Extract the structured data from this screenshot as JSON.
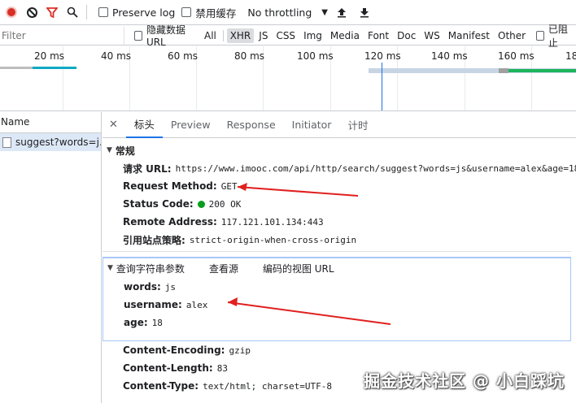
{
  "toolbar": {
    "preserve_log": "Preserve log",
    "disable_cache": "禁用缓存",
    "throttling": "No throttling"
  },
  "filter": {
    "placeholder": "Filter",
    "hide_data_url": "隐藏数据 URL",
    "types": [
      "All",
      "XHR",
      "JS",
      "CSS",
      "Img",
      "Media",
      "Font",
      "Doc",
      "WS",
      "Manifest",
      "Other"
    ],
    "active_type": "XHR",
    "blocked": "已阻止"
  },
  "timeline": {
    "ticks": [
      "20 ms",
      "40 ms",
      "60 ms",
      "80 ms",
      "100 ms",
      "120 ms",
      "140 ms",
      "160 ms",
      "18"
    ]
  },
  "requests": {
    "header": "Name",
    "items": [
      "suggest?words=j..."
    ]
  },
  "details": {
    "tabs": [
      "标头",
      "Preview",
      "Response",
      "Initiator",
      "计时"
    ],
    "active_tab": "标头",
    "general": {
      "title": "常规",
      "rows": [
        {
          "key": "请求 URL:",
          "value": "https://www.imooc.com/api/http/search/suggest?words=js&username=alex&age=18"
        },
        {
          "key": "Request Method:",
          "value": "GET"
        },
        {
          "key": "Status Code:",
          "value": "200 OK"
        },
        {
          "key": "Remote Address:",
          "value": "117.121.101.134:443"
        },
        {
          "key": "引用站点策略:",
          "value": "strict-origin-when-cross-origin"
        }
      ]
    },
    "query": {
      "title": "查询字符串参数",
      "view_source": "查看源",
      "view_decoded": "编码的视图 URL",
      "rows": [
        {
          "key": "words:",
          "value": "js"
        },
        {
          "key": "username:",
          "value": "alex"
        },
        {
          "key": "age:",
          "value": "18"
        }
      ]
    },
    "response_headers": [
      {
        "key": "Content-Encoding:",
        "value": "gzip"
      },
      {
        "key": "Content-Length:",
        "value": "83"
      },
      {
        "key": "Content-Type:",
        "value": "text/html; charset=UTF-8"
      }
    ]
  },
  "watermark": "掘金技术社区 @ 小白踩坑",
  "colors": {
    "accent": "#1a73e8",
    "record": "#d93025",
    "annotation_arrow": "#e0201f",
    "status_ok": "#0a9d1f"
  }
}
